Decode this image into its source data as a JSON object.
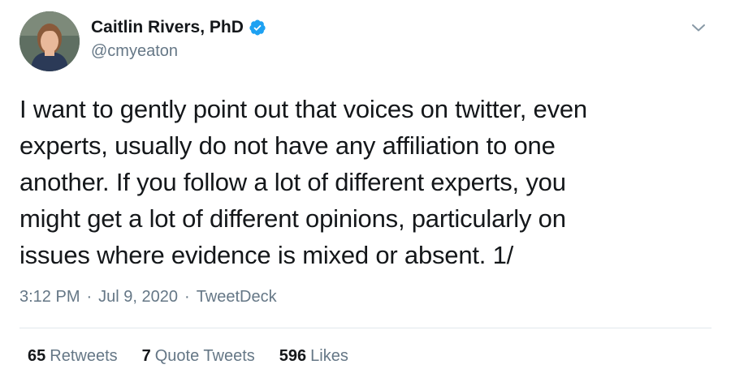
{
  "author": {
    "name": "Caitlin Rivers, PhD",
    "handle": "@cmyeaton",
    "verified_icon": "verified-badge-icon",
    "verified_color": "#1da1f2"
  },
  "tweet": {
    "lines": [
      "I want to gently point out that voices on twitter, even",
      "experts, usually do not have any affiliation to one",
      "another. If you follow a lot of different experts, you",
      "might get a lot of different opinions, particularly on",
      "issues where evidence is mixed or absent. 1/"
    ]
  },
  "meta": {
    "time": "3:12 PM",
    "sep1": "·",
    "date": "Jul 9, 2020",
    "sep2": "·",
    "source": "TweetDeck"
  },
  "stats": {
    "retweets_count": "65",
    "retweets_label": "Retweets",
    "quotes_count": "7",
    "quotes_label": "Quote Tweets",
    "likes_count": "596",
    "likes_label": "Likes"
  },
  "colors": {
    "text": "#14171a",
    "muted": "#657786",
    "divider": "#e1e8ed",
    "accent": "#1da1f2"
  },
  "icons": [
    "avatar",
    "verified-badge-icon",
    "chevron-down-icon"
  ]
}
